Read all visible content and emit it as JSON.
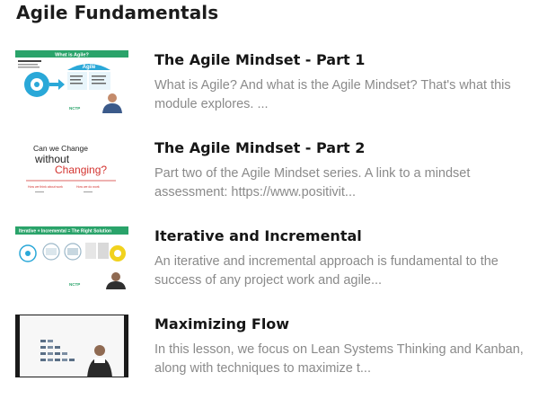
{
  "section": {
    "title": "Agile Fundamentals"
  },
  "lessons": [
    {
      "title": "The Agile Mindset - Part 1",
      "description": "What is Agile?  And what is the Agile Mindset?  That's what this module explores. ...",
      "thumbnail": {
        "banner": "What is Agile?",
        "center_label": "Agile",
        "brand": "NCTP"
      }
    },
    {
      "title": "The Agile Mindset - Part 2",
      "description": "Part two of the Agile Mindset series.  A link to a mindset assessment: https://www.positivit...",
      "thumbnail": {
        "line1": "Can we Change",
        "line2": "without",
        "line3": "Changing?",
        "left_caption": "How we think about work",
        "right_caption": "How we do work"
      }
    },
    {
      "title": "Iterative and Incremental",
      "description": "An iterative and incremental approach is fundamental to the success of any project work and agile...",
      "thumbnail": {
        "banner": "Iterative + Incremental = The Right Solution",
        "brand": "NCTP"
      }
    },
    {
      "title": "Maximizing Flow",
      "description": "In this lesson, we focus on Lean Systems Thinking and Kanban, along with techniques to maximize t...",
      "thumbnail": {}
    }
  ],
  "colors": {
    "heading": "#1c1c1c",
    "description": "#8a8a8a",
    "thumb_blue": "#2aa8d8",
    "thumb_green": "#2aa36a",
    "thumb_red": "#d3332f"
  }
}
